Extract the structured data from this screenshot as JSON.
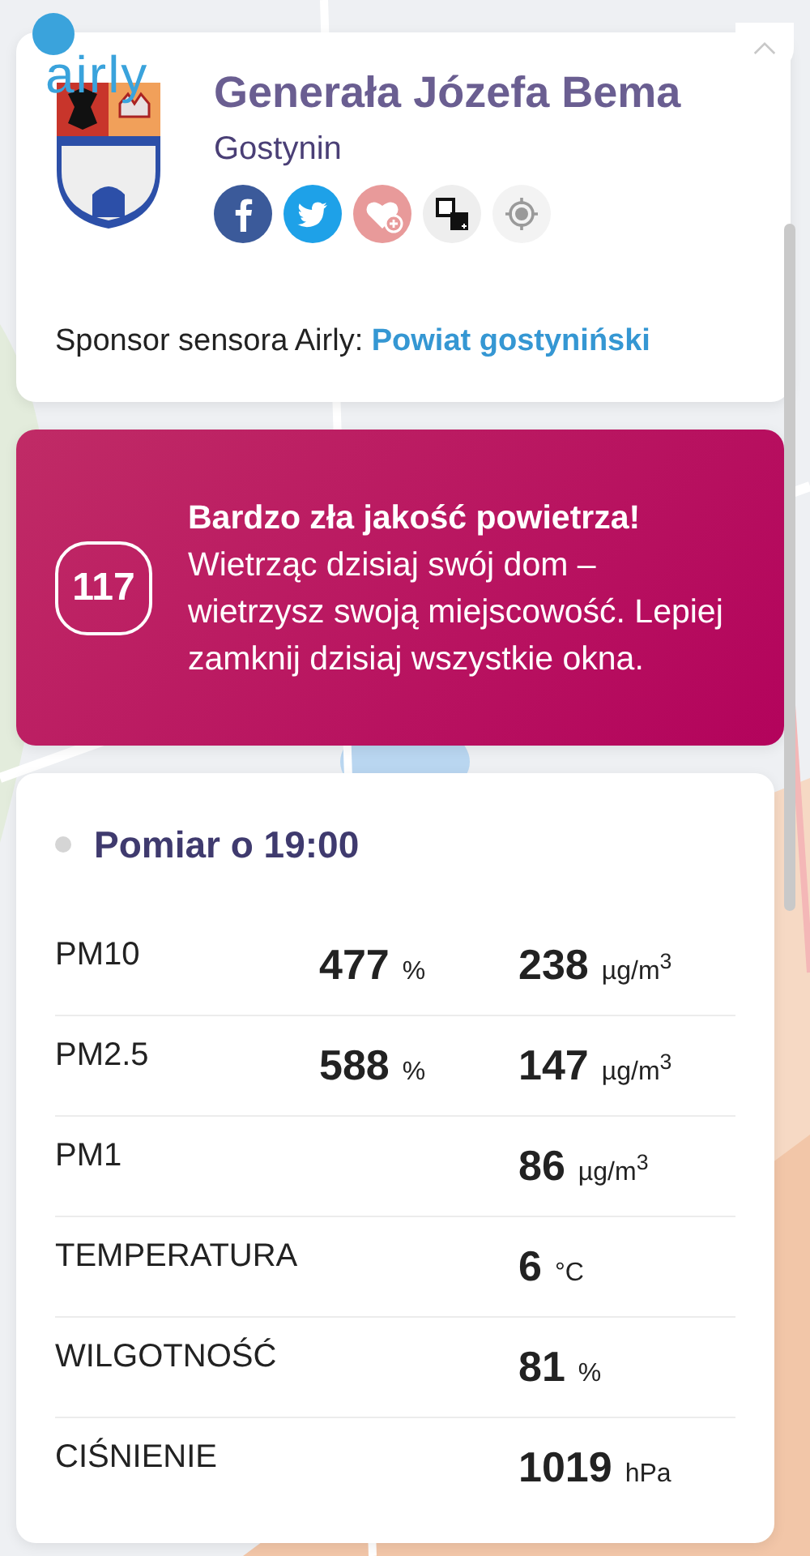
{
  "logo": {
    "text": "airly"
  },
  "location": {
    "street": "Generała Józefa Bema",
    "city": "Gostynin",
    "actions": [
      {
        "kind": "facebook"
      },
      {
        "kind": "twitter"
      },
      {
        "kind": "favorite"
      },
      {
        "kind": "embed"
      },
      {
        "kind": "locate"
      }
    ]
  },
  "sponsor": {
    "label": "Sponsor sensora Airly:",
    "link": "Powiat gostyniński"
  },
  "alert": {
    "index": "117",
    "title": "Bardzo zła jakość powietrza!",
    "message": "Wietrząc dzisiaj swój dom – wietrzysz swoją miejscowość. Lepiej zamknij dzisiaj wszystkie okna."
  },
  "measurement": {
    "title": "Pomiar o 19:00",
    "rows": [
      {
        "label": "PM10",
        "percent": "477",
        "percent_unit": "%",
        "value": "238",
        "unit": "µg/m$^{3}$"
      },
      {
        "label": "PM2.5",
        "percent": "588",
        "percent_unit": "%",
        "value": "147",
        "unit": "µg/m$^{3}$"
      },
      {
        "label": "PM1",
        "value": "86",
        "unit": "µg/m$^{3}$"
      },
      {
        "label": "TEMPERATURA",
        "value": "6",
        "unit": "°C"
      },
      {
        "label": "WILGOTNOŚĆ",
        "value": "81",
        "unit": "%"
      },
      {
        "label": "CIŚNIENIE",
        "value": "1019",
        "unit": "hPa"
      }
    ]
  }
}
